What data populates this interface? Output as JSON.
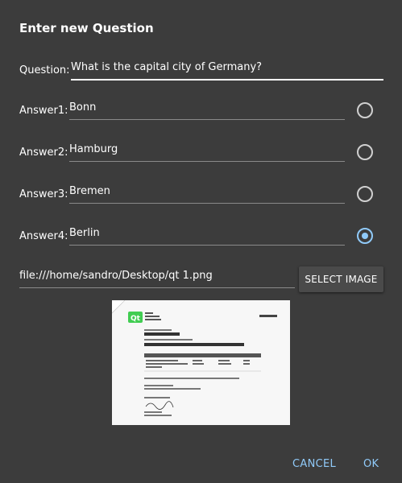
{
  "dialog": {
    "title": "Enter new Question"
  },
  "question": {
    "label": "Question:",
    "value": "What is the capital city of Germany?"
  },
  "answers": [
    {
      "label": "Answer1:",
      "value": "Bonn",
      "checked": false
    },
    {
      "label": "Answer2:",
      "value": "Hamburg",
      "checked": false
    },
    {
      "label": "Answer3:",
      "value": "Bremen",
      "checked": false
    },
    {
      "label": "Answer4:",
      "value": "Berlin",
      "checked": true
    }
  ],
  "image": {
    "path": "file:///home/sandro/Desktop/qt 1.png",
    "select_label": "SELECT IMAGE"
  },
  "actions": {
    "cancel_label": "CANCEL",
    "ok_label": "OK"
  },
  "colors": {
    "background": "#3c3c3c",
    "accent": "#90caf9",
    "qt_green": "#41cd52"
  }
}
